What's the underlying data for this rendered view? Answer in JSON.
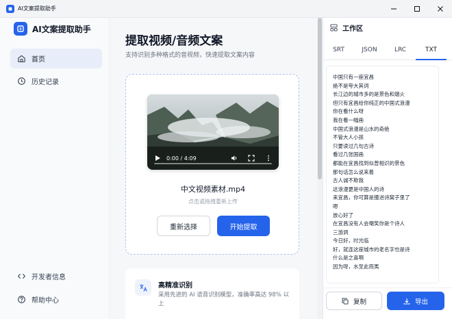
{
  "window": {
    "title": "AI文案提取助手"
  },
  "sidebar": {
    "brand": "AI文案提取助手",
    "nav": [
      {
        "label": "首页",
        "icon": "home-icon",
        "active": true
      },
      {
        "label": "历史记录",
        "icon": "clock-icon",
        "active": false
      }
    ],
    "bottom_nav": [
      {
        "label": "开发者信息",
        "icon": "code-icon"
      },
      {
        "label": "帮助中心",
        "icon": "help-icon"
      }
    ]
  },
  "main": {
    "title": "提取视频/音频文案",
    "subtitle": "支持识别多种格式的音视频，快速提取文案内容",
    "upload": {
      "time_display": "0:00 / 4:09",
      "file_name": "中文视频素材.mp4",
      "hint": "点击或拖拽重新上传",
      "reselect_label": "重新选择",
      "start_label": "开始提取"
    },
    "feature": {
      "title": "高精准识别",
      "description": "采用先进的 AI 语音识别模型，准确率高达 98% 以上"
    }
  },
  "panel": {
    "title": "工作区",
    "tabs": [
      "SRT",
      "JSON",
      "LRC",
      "TXT"
    ],
    "active_tab": "TXT",
    "lines": [
      "中国只有一座宜昌",
      "绝不是夸大其词",
      "长江边的城市多的是景色和烟火",
      "但只有宜昌给你纯正的中国式浪漫",
      "你在看什么呀",
      "我在看一幅画",
      "中国式浪漫是山水的奇绝",
      "不管大人小孩",
      "只要读过几句古诗",
      "看过几张国画",
      "都能在宜昌找到似曾相识的景色",
      "那句话怎么说来着",
      "古人诚不欺我",
      "这浪漫更是中国人的诗",
      "来宜昌，你可算是撞进诗窝子里了",
      "嗯",
      "放心好了",
      "在宜昌没有人会嘲笑你是个诗人",
      "三游洞",
      "今日好，时光临",
      "好，就连这座城市的老名字也是诗",
      "什么是之喜啊",
      "因为呀，水至此而夷"
    ],
    "copy_label": "复制",
    "export_label": "导出"
  },
  "colors": {
    "accent": "#2563eb",
    "sidebar_active": "#e8eef9",
    "main_bg": "#f6f7f9"
  }
}
